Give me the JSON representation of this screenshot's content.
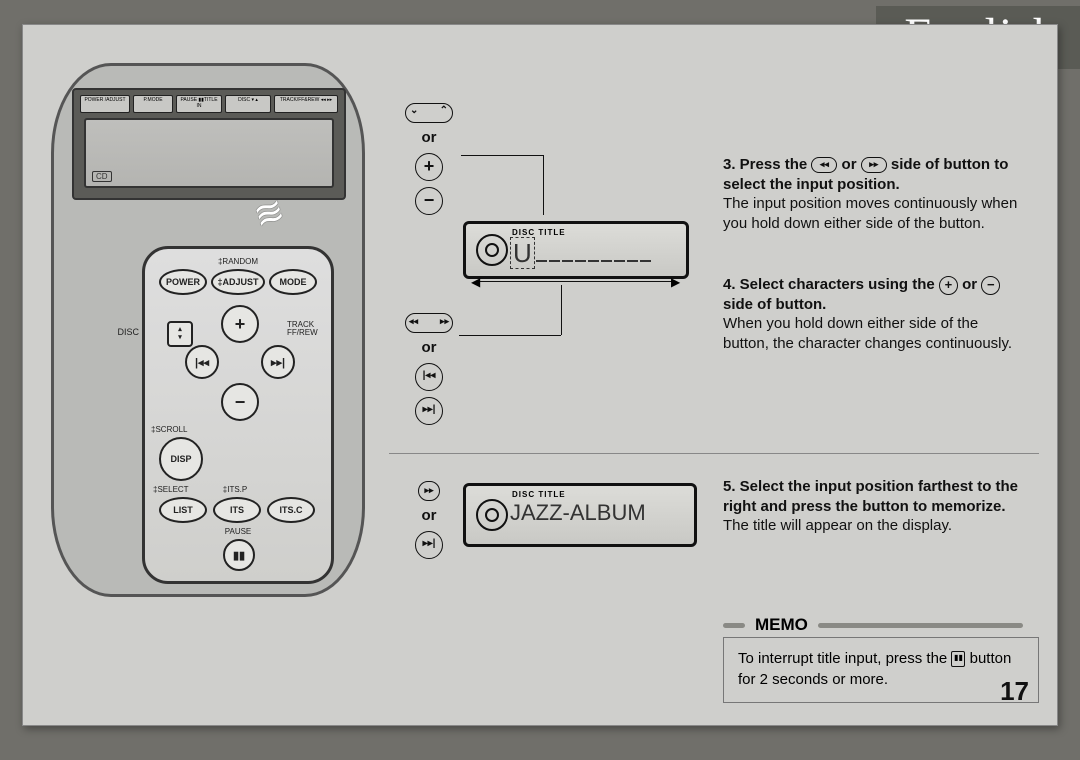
{
  "language": "English",
  "page_number": "17",
  "unit_top_buttons": [
    "POWER /ADJUST",
    "P.MODE",
    "PAUSE ▮▮TITLE IN",
    "DISC ▾ ▴",
    "TRACK/FF&REW ◂◂ ▸▸"
  ],
  "remote": {
    "row1_label": "‡RANDOM",
    "row1": [
      "POWER",
      "‡ADJUST",
      "MODE"
    ],
    "left_label": "DISC",
    "right_label": "TRACK FF/REW",
    "plus": "+",
    "minus": "−",
    "left": "|◂◂",
    "right": "▸▸|",
    "disp_label": "‡SCROLL",
    "disp": "DISP",
    "row3_labels": [
      "‡SELECT",
      "‡ITS.P",
      ""
    ],
    "row3": [
      "LIST",
      "ITS",
      "ITS.C"
    ],
    "pause_label": "PAUSE",
    "pause": "▮▮"
  },
  "ctrl_group1": {
    "or": "or"
  },
  "ctrl_group2": {
    "or": "or"
  },
  "ctrl_group3": {
    "or": "or"
  },
  "lcd1": {
    "tag": "DISC TITLE",
    "char": "U"
  },
  "lcd2": {
    "tag": "DISC TITLE",
    "text": "JAZZ-ALBUM"
  },
  "step3": {
    "lead": "3. Press the ",
    "mid": " or ",
    "tail": " side of button to select the input position.",
    "body": "The input position moves continuously when you hold down either side of the button."
  },
  "step4": {
    "lead": "4. Select characters using the ",
    "mid": " or ",
    "tail": " side of button.",
    "body": "When you hold down either side of the button, the character changes continuously."
  },
  "step5": {
    "title": "5. Select the input position farthest to the right and press the button to memorize.",
    "body": "The title will appear on the display."
  },
  "memo": {
    "heading": "MEMO",
    "t1": "To interrupt title input, press the ",
    "t2": " button for 2 seconds or more.",
    "btn": "▮▮"
  }
}
